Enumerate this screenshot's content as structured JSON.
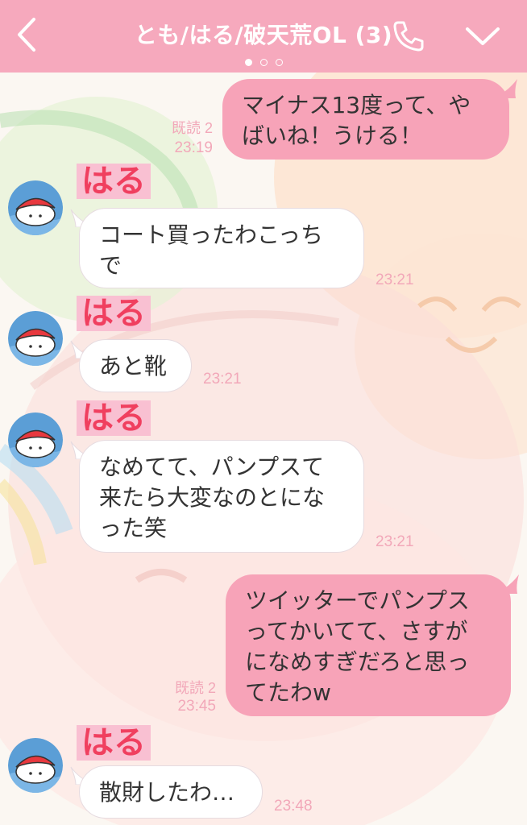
{
  "header": {
    "title": "とも/はる/破天荒OL (3)",
    "back_icon": "chevron-left-icon",
    "call_icon": "phone-icon",
    "menu_icon": "chevron-down-icon",
    "page_dots": 3,
    "active_dot": 1
  },
  "colors": {
    "header_bg": "#f6a9bd",
    "outgoing_bubble": "#f7a3b8",
    "incoming_bubble": "#ffffff",
    "timestamp": "#f2a8b9",
    "sender_name": "#f03f5f",
    "sender_name_bg": "#f9c0d2"
  },
  "messages": [
    {
      "dir": "out",
      "text": "マイナス13度って、や\nばいね！うける！",
      "read": "既読 2",
      "time": "23:19"
    },
    {
      "dir": "in",
      "sender": "はる",
      "text": "コート買ったわこっち\nで",
      "time": "23:21"
    },
    {
      "dir": "in",
      "sender": "はる",
      "text": "あと靴",
      "time": "23:21"
    },
    {
      "dir": "in",
      "sender": "はる",
      "text": "なめてて、パンプスて\n来たら大変なのとにな\nった笑",
      "time": "23:21"
    },
    {
      "dir": "out",
      "text": "ツイッターでパンプス\nってかいてて、さすが\nになめすぎだろと思っ\nてたわw",
      "read": "既読 2",
      "time": "23:45"
    },
    {
      "dir": "in",
      "sender": "はる",
      "text": "散財したわ…",
      "time": "23:48"
    }
  ]
}
